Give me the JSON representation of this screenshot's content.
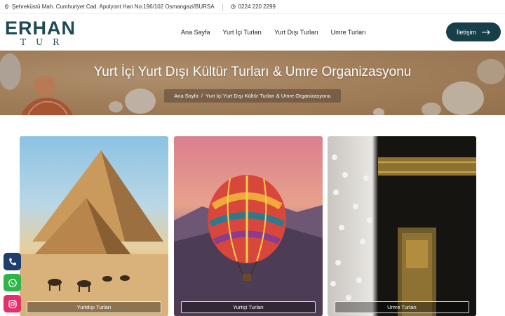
{
  "topbar": {
    "address": "Şehreküstü Mah. Cumhuriyet Cad. Apolyont Han No:196/102 Osmangazi/BURSA",
    "phone": "0224 220 2299"
  },
  "logo": {
    "line1": "ERHAN",
    "line2": "TUR"
  },
  "nav": {
    "items": [
      "Ana Sayfa",
      "Yurt İçi Turları",
      "Yurt Dışı Turları",
      "Umre Turları"
    ]
  },
  "cta": {
    "label": "İletişim"
  },
  "hero": {
    "title": "Yurt İçi Yurt Dışı Kültür Turları & Umre Organizasyonu",
    "breadcrumb": {
      "home": "Ana Sayfa",
      "separator": "/",
      "current": "Yurt İçi Yurt Dışı Kültür Turları & Umre Organizasyonu"
    }
  },
  "cards": [
    {
      "label": "Yurtdışı Turları"
    },
    {
      "label": "Yurtiçi Turları"
    },
    {
      "label": "Umre Turları"
    }
  ],
  "colors": {
    "brand": "#173f4a",
    "phone": "#1d3f6e",
    "whatsapp": "#2fb44a",
    "instagram": "#e1306c"
  },
  "social_icons": [
    "phone-icon",
    "whatsapp-icon",
    "instagram-icon"
  ]
}
